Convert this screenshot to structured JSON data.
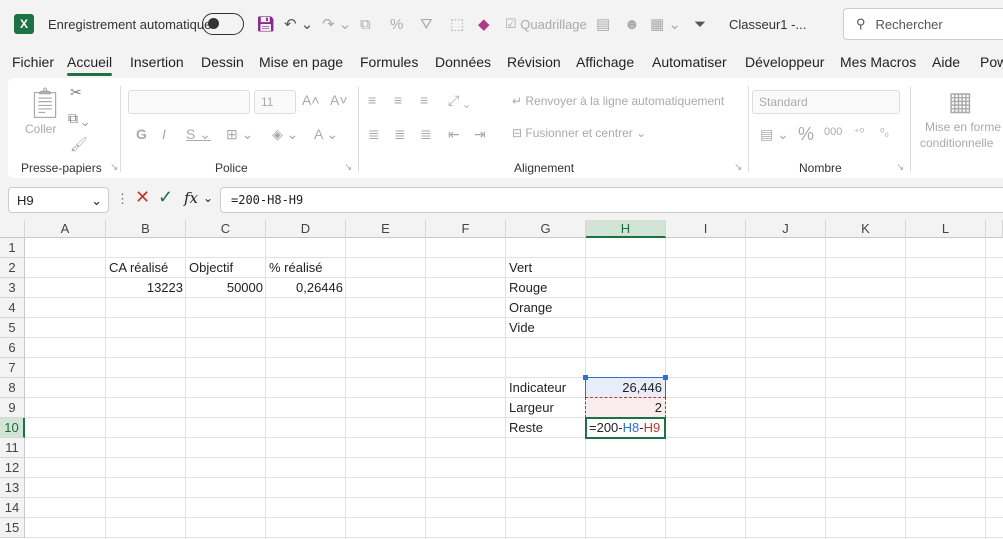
{
  "titlebar": {
    "autosave_label": "Enregistrement automatique",
    "gridlines_label": "Quadrillage",
    "doc_title": "Classeur1  -...",
    "search_placeholder": "Rechercher"
  },
  "tabs": [
    "Fichier",
    "Accueil",
    "Insertion",
    "Dessin",
    "Mise en page",
    "Formules",
    "Données",
    "Révision",
    "Affichage",
    "Automatiser",
    "Développeur",
    "Mes Macros",
    "Aide",
    "Pow"
  ],
  "ribbon": {
    "paste_label": "Coller",
    "clipboard_group": "Presse-papiers",
    "font_name": "",
    "font_size": "11",
    "font_group": "Police",
    "wrap_label": "Renvoyer à la ligne automatiquement",
    "merge_label": "Fusionner et centrer",
    "align_group": "Alignement",
    "number_format": "Standard",
    "number_group": "Nombre",
    "cond_format_1": "Mise en forme",
    "cond_format_2": "conditionnelle"
  },
  "formula_bar": {
    "name_box": "H9",
    "fx": "fx",
    "formula": "=200-H8-H9"
  },
  "columns": [
    "A",
    "B",
    "C",
    "D",
    "E",
    "F",
    "G",
    "H",
    "I",
    "J",
    "K",
    "L"
  ],
  "rows": [
    "1",
    "2",
    "3",
    "4",
    "5",
    "6",
    "7",
    "8",
    "9",
    "10",
    "11",
    "12",
    "13",
    "14",
    "15"
  ],
  "cells": {
    "B2": "CA réalisé",
    "C2": "Objectif",
    "D2": "% réalisé",
    "B3": "13223",
    "C3": "50000",
    "D3": "0,26446",
    "G2": "Vert",
    "G3": "Rouge",
    "G4": "Orange",
    "G5": "Vide",
    "G8": "Indicateur",
    "H8": "26,446",
    "G9": "Largeur",
    "H9": "2",
    "G10": "Reste",
    "H10_a": "=200-",
    "H10_b": "H8",
    "H10_c": "-",
    "H10_d": "H9"
  },
  "colors": {
    "accent": "#1e7145",
    "ref_blue": "#2e6fd0",
    "ref_red": "#c0392b"
  }
}
